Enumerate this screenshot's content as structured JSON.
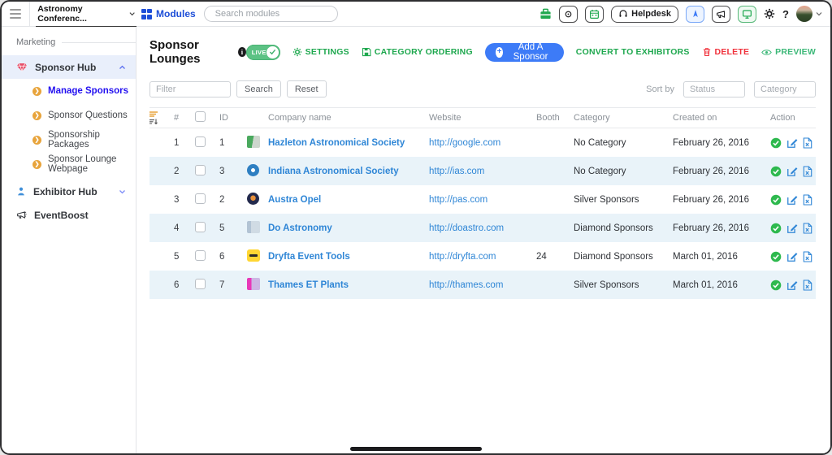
{
  "topbar": {
    "event_selector": "Astronomy Conferenc...",
    "modules_label": "Modules",
    "search_placeholder": "Search modules",
    "helpdesk_label": "Helpdesk",
    "help_label": "?"
  },
  "sidebar": {
    "section_label": "Marketing",
    "sponsor_hub": "Sponsor Hub",
    "sub_items": [
      "Manage Sponsors",
      "Sponsor Questions",
      "Sponsorship Packages",
      "Sponsor Lounge Webpage"
    ],
    "exhibitor_hub": "Exhibitor Hub",
    "eventboost": "EventBoost"
  },
  "toolbar": {
    "title": "Sponsor Lounges",
    "live_label": "LIVE",
    "settings_label": "SETTINGS",
    "category_ordering_label": "CATEGORY ORDERING",
    "add_sponsor_label": "Add A Sponsor",
    "convert_label": "CONVERT TO EXHIBITORS",
    "delete_label": "DELETE",
    "preview_label": "PREVIEW"
  },
  "filters": {
    "filter_placeholder": "Filter",
    "search_label": "Search",
    "reset_label": "Reset",
    "sort_by_label": "Sort by",
    "status_placeholder": "Status",
    "category_placeholder": "Category"
  },
  "table": {
    "headers": [
      "#",
      "ID",
      "Company name",
      "Website",
      "Booth",
      "Category",
      "Created on",
      "Action"
    ],
    "rows": [
      {
        "num": "1",
        "id": "1",
        "logo": "lg1",
        "company": "Hazleton Astronomical Society",
        "website": "http://google.com",
        "booth": "",
        "category": "No Category",
        "created": "February 26, 2016"
      },
      {
        "num": "2",
        "id": "3",
        "logo": "lg2",
        "company": "Indiana Astronomical Society",
        "website": "http://ias.com",
        "booth": "",
        "category": "No Category",
        "created": "February 26, 2016"
      },
      {
        "num": "3",
        "id": "2",
        "logo": "lg3",
        "company": "Austra Opel",
        "website": "http://pas.com",
        "booth": "",
        "category": "Silver Sponsors",
        "created": "February 26, 2016"
      },
      {
        "num": "4",
        "id": "5",
        "logo": "lg4",
        "company": "Do Astronomy",
        "website": "http://doastro.com",
        "booth": "",
        "category": "Diamond Sponsors",
        "created": "February 26, 2016"
      },
      {
        "num": "5",
        "id": "6",
        "logo": "lg5",
        "company": "Dryfta Event Tools",
        "website": "http://dryfta.com",
        "booth": "24",
        "category": "Diamond Sponsors",
        "created": "March 01, 2016"
      },
      {
        "num": "6",
        "id": "7",
        "logo": "lg6",
        "company": "Thames ET Plants",
        "website": "http://thames.com",
        "booth": "",
        "category": "Silver Sponsors",
        "created": "March 01, 2016"
      }
    ]
  },
  "colors": {
    "green_accent": "#1fa84f",
    "toggle_green": "#5cc284",
    "blue_button": "#3d7bf7",
    "red_accent": "#f0303a",
    "link_blue": "#2f86d6",
    "active_nav_blue": "#2310f0",
    "orange_accent": "#e8a43c",
    "alt_row_bg": "#e9f3f9"
  }
}
